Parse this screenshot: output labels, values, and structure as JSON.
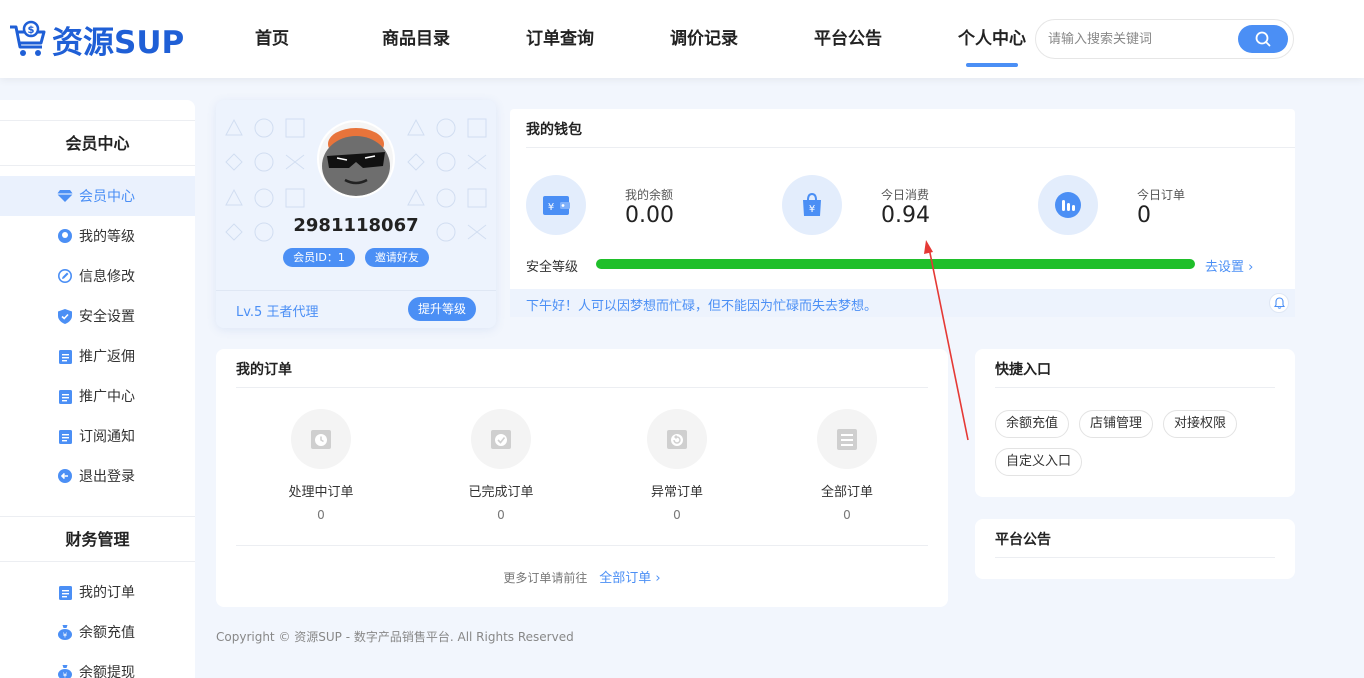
{
  "brand": {
    "name": "资源SUP"
  },
  "nav": {
    "items": [
      "首页",
      "商品目录",
      "订单查询",
      "调价记录",
      "平台公告",
      "个人中心"
    ]
  },
  "search": {
    "placeholder": "请输入搜索关键词"
  },
  "sidebar": {
    "section1_title": "会员中心",
    "section1_items": [
      {
        "label": "会员中心",
        "icon": "diamond-icon"
      },
      {
        "label": "我的等级",
        "icon": "level-icon"
      },
      {
        "label": "信息修改",
        "icon": "edit-icon"
      },
      {
        "label": "安全设置",
        "icon": "shield-icon"
      },
      {
        "label": "推广返佣",
        "icon": "clipboard-icon"
      },
      {
        "label": "推广中心",
        "icon": "clipboard-icon"
      },
      {
        "label": "订阅通知",
        "icon": "clipboard-icon"
      },
      {
        "label": "退出登录",
        "icon": "logout-icon"
      }
    ],
    "section2_title": "财务管理",
    "section2_items": [
      {
        "label": "我的订单",
        "icon": "clipboard-icon"
      },
      {
        "label": "余额充值",
        "icon": "money-bag-icon"
      },
      {
        "label": "余额提现",
        "icon": "money-bag-icon"
      }
    ]
  },
  "profile": {
    "username": "2981118067",
    "member_id": "会员ID：1",
    "invite": "邀请好友",
    "level": "Lv.5 王者代理",
    "upgrade": "提升等级"
  },
  "wallet": {
    "title": "我的钱包",
    "stats": [
      {
        "label": "我的余额",
        "value": "0.00",
        "icon": "wallet-icon"
      },
      {
        "label": "今日消费",
        "value": "0.94",
        "icon": "shopping-bag-icon"
      },
      {
        "label": "今日订单",
        "value": "0",
        "icon": "bar-chart-icon"
      }
    ],
    "security_label": "安全等级",
    "security_level": 1.0,
    "security_link": "去设置",
    "greeting": "下午好！人可以因梦想而忙碌，但不能因为忙碌而失去梦想。"
  },
  "orders": {
    "title": "我的订单",
    "items": [
      {
        "label": "处理中订单",
        "count": "0"
      },
      {
        "label": "已完成订单",
        "count": "0"
      },
      {
        "label": "异常订单",
        "count": "0"
      },
      {
        "label": "全部订单",
        "count": "0"
      }
    ],
    "footer_text": "更多订单请前往",
    "footer_link": "全部订单"
  },
  "quick": {
    "title": "快捷入口",
    "items": [
      "余额充值",
      "店铺管理",
      "对接权限",
      "自定义入口"
    ]
  },
  "notice": {
    "title": "平台公告"
  },
  "footer": {
    "copyright": "Copyright © 资源SUP - 数字产品销售平台. All Rights Reserved"
  },
  "colors": {
    "primary": "#4b8ff5",
    "brand": "#1f5fd6",
    "progress": "#1fbf2a",
    "annotation": "#e53935"
  }
}
